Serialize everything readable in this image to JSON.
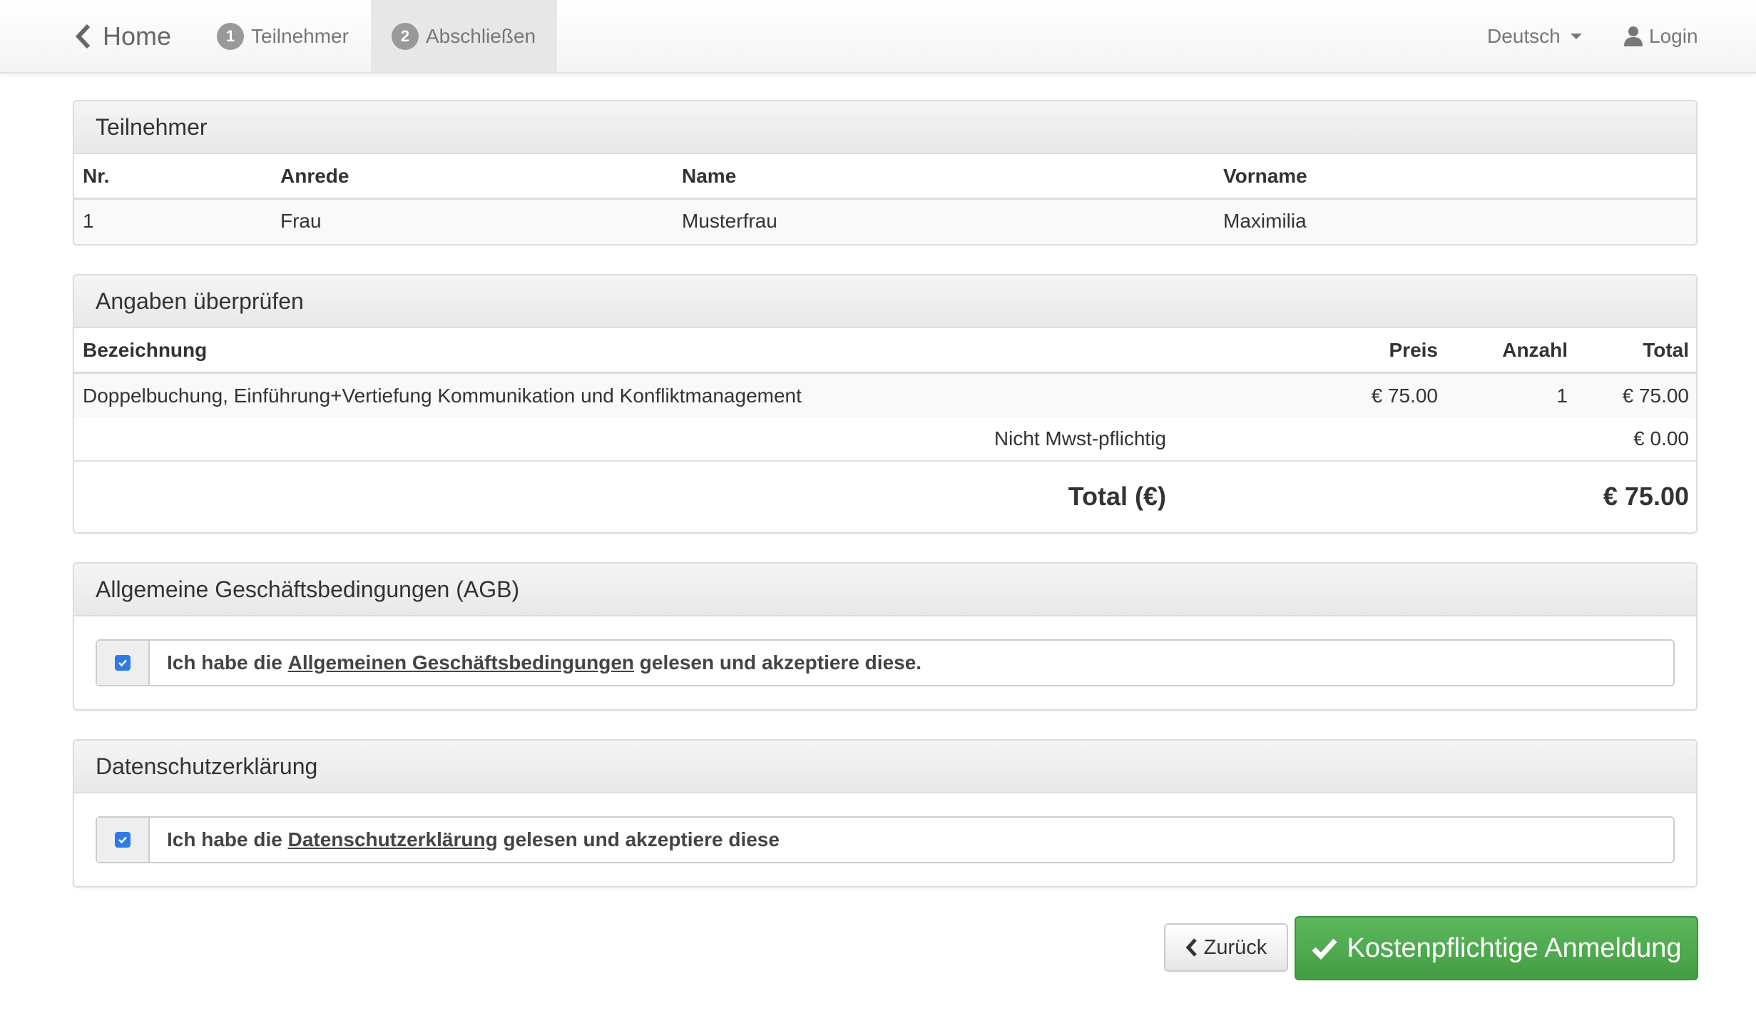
{
  "nav": {
    "home_label": "Home",
    "steps": [
      {
        "number": "1",
        "label": "Teilnehmer"
      },
      {
        "number": "2",
        "label": "Abschließen"
      }
    ],
    "language": "Deutsch",
    "login_label": "Login"
  },
  "participants": {
    "title": "Teilnehmer",
    "headers": {
      "nr": "Nr.",
      "anrede": "Anrede",
      "name": "Name",
      "vorname": "Vorname"
    },
    "rows": [
      {
        "nr": "1",
        "anrede": "Frau",
        "name": "Musterfrau",
        "vorname": "Maximilia"
      }
    ]
  },
  "review": {
    "title": "Angaben überprüfen",
    "headers": {
      "bezeichnung": "Bezeichnung",
      "preis": "Preis",
      "anzahl": "Anzahl",
      "total": "Total"
    },
    "items": [
      {
        "bezeichnung": "Doppelbuchung, Einführung+Vertiefung Kommunikation und Konfliktmanagement",
        "preis": "€ 75.00",
        "anzahl": "1",
        "total": "€ 75.00"
      }
    ],
    "vat_label": "Nicht Mwst-pflichtig",
    "vat_value": "€ 0.00",
    "grand_total_label": "Total (€)",
    "grand_total_value": "€ 75.00"
  },
  "agb": {
    "title": "Allgemeine Geschäftsbedingungen (AGB)",
    "text_before": "Ich habe die ",
    "link_text": "Allgemeinen Geschäftsbedingungen",
    "text_after": " gelesen und akzeptiere diese.",
    "checked": true
  },
  "privacy": {
    "title": "Datenschutzerklärung",
    "text_before": "Ich habe die ",
    "link_text": "Datenschutzerklärung",
    "text_after": " gelesen und akzeptiere diese",
    "checked": true
  },
  "buttons": {
    "back_label": "Zurück",
    "submit_label": "Kostenpflichtige Anmeldung"
  },
  "colors": {
    "submit_green": "#5cb85c",
    "checkbox_blue": "#2f7ae5",
    "heading_gray": "#e8e8e8"
  }
}
